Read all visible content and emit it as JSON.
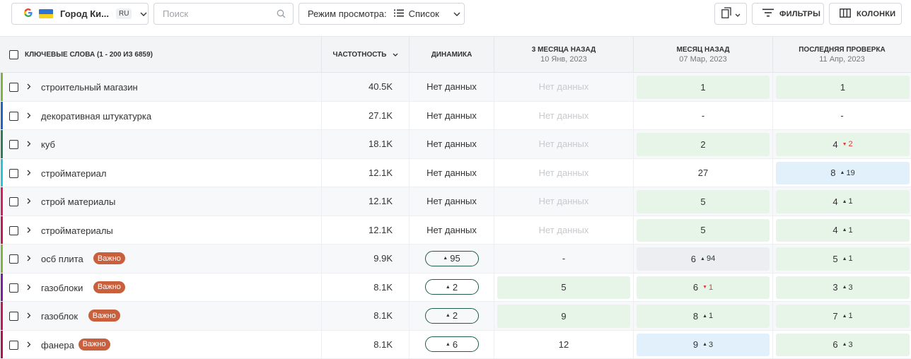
{
  "toolbar": {
    "location_name": "Город Ки...",
    "language": "RU",
    "search_placeholder": "Поиск",
    "view_mode_label": "Режим просмотра:",
    "view_mode_value": "Список",
    "filters_label": "ФИЛЬТРЫ",
    "columns_label": "КОЛОНКИ"
  },
  "table": {
    "headers": {
      "keywords": "КЛЮЧЕВЫЕ СЛОВА (1 - 200 ИЗ 6859)",
      "frequency": "ЧАСТОТНОСТЬ",
      "dynamics": "ДИНАМИКА",
      "three_months": "3 МЕСЯЦА НАЗАД",
      "three_months_date": "10 Янв, 2023",
      "month": "МЕСЯЦ НАЗАД",
      "month_date": "07 Мар, 2023",
      "last": "ПОСЛЕДНЯЯ ПРОВЕРКА",
      "last_date": "11 Апр, 2023"
    },
    "rows": [
      {
        "keyword": "строительный магазин",
        "bar_color": "#7cb342",
        "badge": "",
        "frequency": "40.5K",
        "dynamics": "Нет данных",
        "dynamics_pill": "",
        "dynamics_dir": "",
        "m3": "Нет данных",
        "m3_style": "nodata",
        "m1": "1",
        "m1_change": "",
        "m1_dir": "",
        "m1_bg": "green",
        "last": "1",
        "last_change": "",
        "last_dir": "",
        "last_bg": "green"
      },
      {
        "keyword": "декоративная штукатурка",
        "bar_color": "#1e63c7",
        "badge": "",
        "frequency": "27.1K",
        "dynamics": "Нет данных",
        "dynamics_pill": "",
        "dynamics_dir": "",
        "m3": "Нет данных",
        "m3_style": "nodata",
        "m1": "-",
        "m1_change": "",
        "m1_dir": "",
        "m1_bg": "",
        "last": "-",
        "last_change": "",
        "last_dir": "",
        "last_bg": ""
      },
      {
        "keyword": "куб",
        "bar_color": "#2e7d55",
        "badge": "",
        "frequency": "18.1K",
        "dynamics": "Нет данных",
        "dynamics_pill": "",
        "dynamics_dir": "",
        "m3": "Нет данных",
        "m3_style": "nodata",
        "m1": "2",
        "m1_change": "",
        "m1_dir": "",
        "m1_bg": "green",
        "last": "4",
        "last_change": "2",
        "last_dir": "down",
        "last_bg": "green"
      },
      {
        "keyword": "стройматериал",
        "bar_color": "#26c6da",
        "badge": "",
        "frequency": "12.1K",
        "dynamics": "Нет данных",
        "dynamics_pill": "",
        "dynamics_dir": "",
        "m3": "Нет данных",
        "m3_style": "nodata",
        "m1": "27",
        "m1_change": "",
        "m1_dir": "",
        "m1_bg": "",
        "last": "8",
        "last_change": "19",
        "last_dir": "up",
        "last_bg": "blue"
      },
      {
        "keyword": "строй материалы",
        "bar_color": "#d81b60",
        "badge": "",
        "frequency": "12.1K",
        "dynamics": "Нет данных",
        "dynamics_pill": "",
        "dynamics_dir": "",
        "m3": "Нет данных",
        "m3_style": "nodata",
        "m1": "5",
        "m1_change": "",
        "m1_dir": "",
        "m1_bg": "green",
        "last": "4",
        "last_change": "1",
        "last_dir": "up",
        "last_bg": "green"
      },
      {
        "keyword": "стройматериалы",
        "bar_color": "#c2185b",
        "badge": "",
        "frequency": "12.1K",
        "dynamics": "Нет данных",
        "dynamics_pill": "",
        "dynamics_dir": "",
        "m3": "Нет данных",
        "m3_style": "nodata",
        "m1": "5",
        "m1_change": "",
        "m1_dir": "",
        "m1_bg": "green",
        "last": "4",
        "last_change": "1",
        "last_dir": "up",
        "last_bg": "green"
      },
      {
        "keyword": "осб плита",
        "bar_color": "#7cb342",
        "badge": "Важно",
        "frequency": "9.9K",
        "dynamics": "",
        "dynamics_pill": "95",
        "dynamics_dir": "up",
        "m3": "-",
        "m3_style": "",
        "m1": "6",
        "m1_change": "94",
        "m1_dir": "up",
        "m1_bg": "gray",
        "last": "5",
        "last_change": "1",
        "last_dir": "up",
        "last_bg": "green"
      },
      {
        "keyword": "газоблоки",
        "bar_color": "#7b1fa2",
        "badge": "Важно",
        "frequency": "8.1K",
        "dynamics": "",
        "dynamics_pill": "2",
        "dynamics_dir": "up",
        "m3": "5",
        "m3_style": "green",
        "m1": "6",
        "m1_change": "1",
        "m1_dir": "down",
        "m1_bg": "green",
        "last": "3",
        "last_change": "3",
        "last_dir": "up",
        "last_bg": "green"
      },
      {
        "keyword": "газоблок",
        "bar_color": "#c2185b",
        "badge": "Важно",
        "frequency": "8.1K",
        "dynamics": "",
        "dynamics_pill": "2",
        "dynamics_dir": "up",
        "m3": "9",
        "m3_style": "green",
        "m1": "8",
        "m1_change": "1",
        "m1_dir": "up",
        "m1_bg": "green",
        "last": "7",
        "last_change": "1",
        "last_dir": "up",
        "last_bg": "green"
      },
      {
        "keyword": "фанера",
        "bar_color": "#ad1457",
        "badge": "Важно",
        "frequency": "8.1K",
        "dynamics": "",
        "dynamics_pill": "6",
        "dynamics_dir": "up",
        "m3": "12",
        "m3_style": "",
        "m1": "9",
        "m1_change": "3",
        "m1_dir": "up",
        "m1_bg": "blue",
        "last": "6",
        "last_change": "3",
        "last_dir": "up",
        "last_bg": "green"
      }
    ]
  }
}
